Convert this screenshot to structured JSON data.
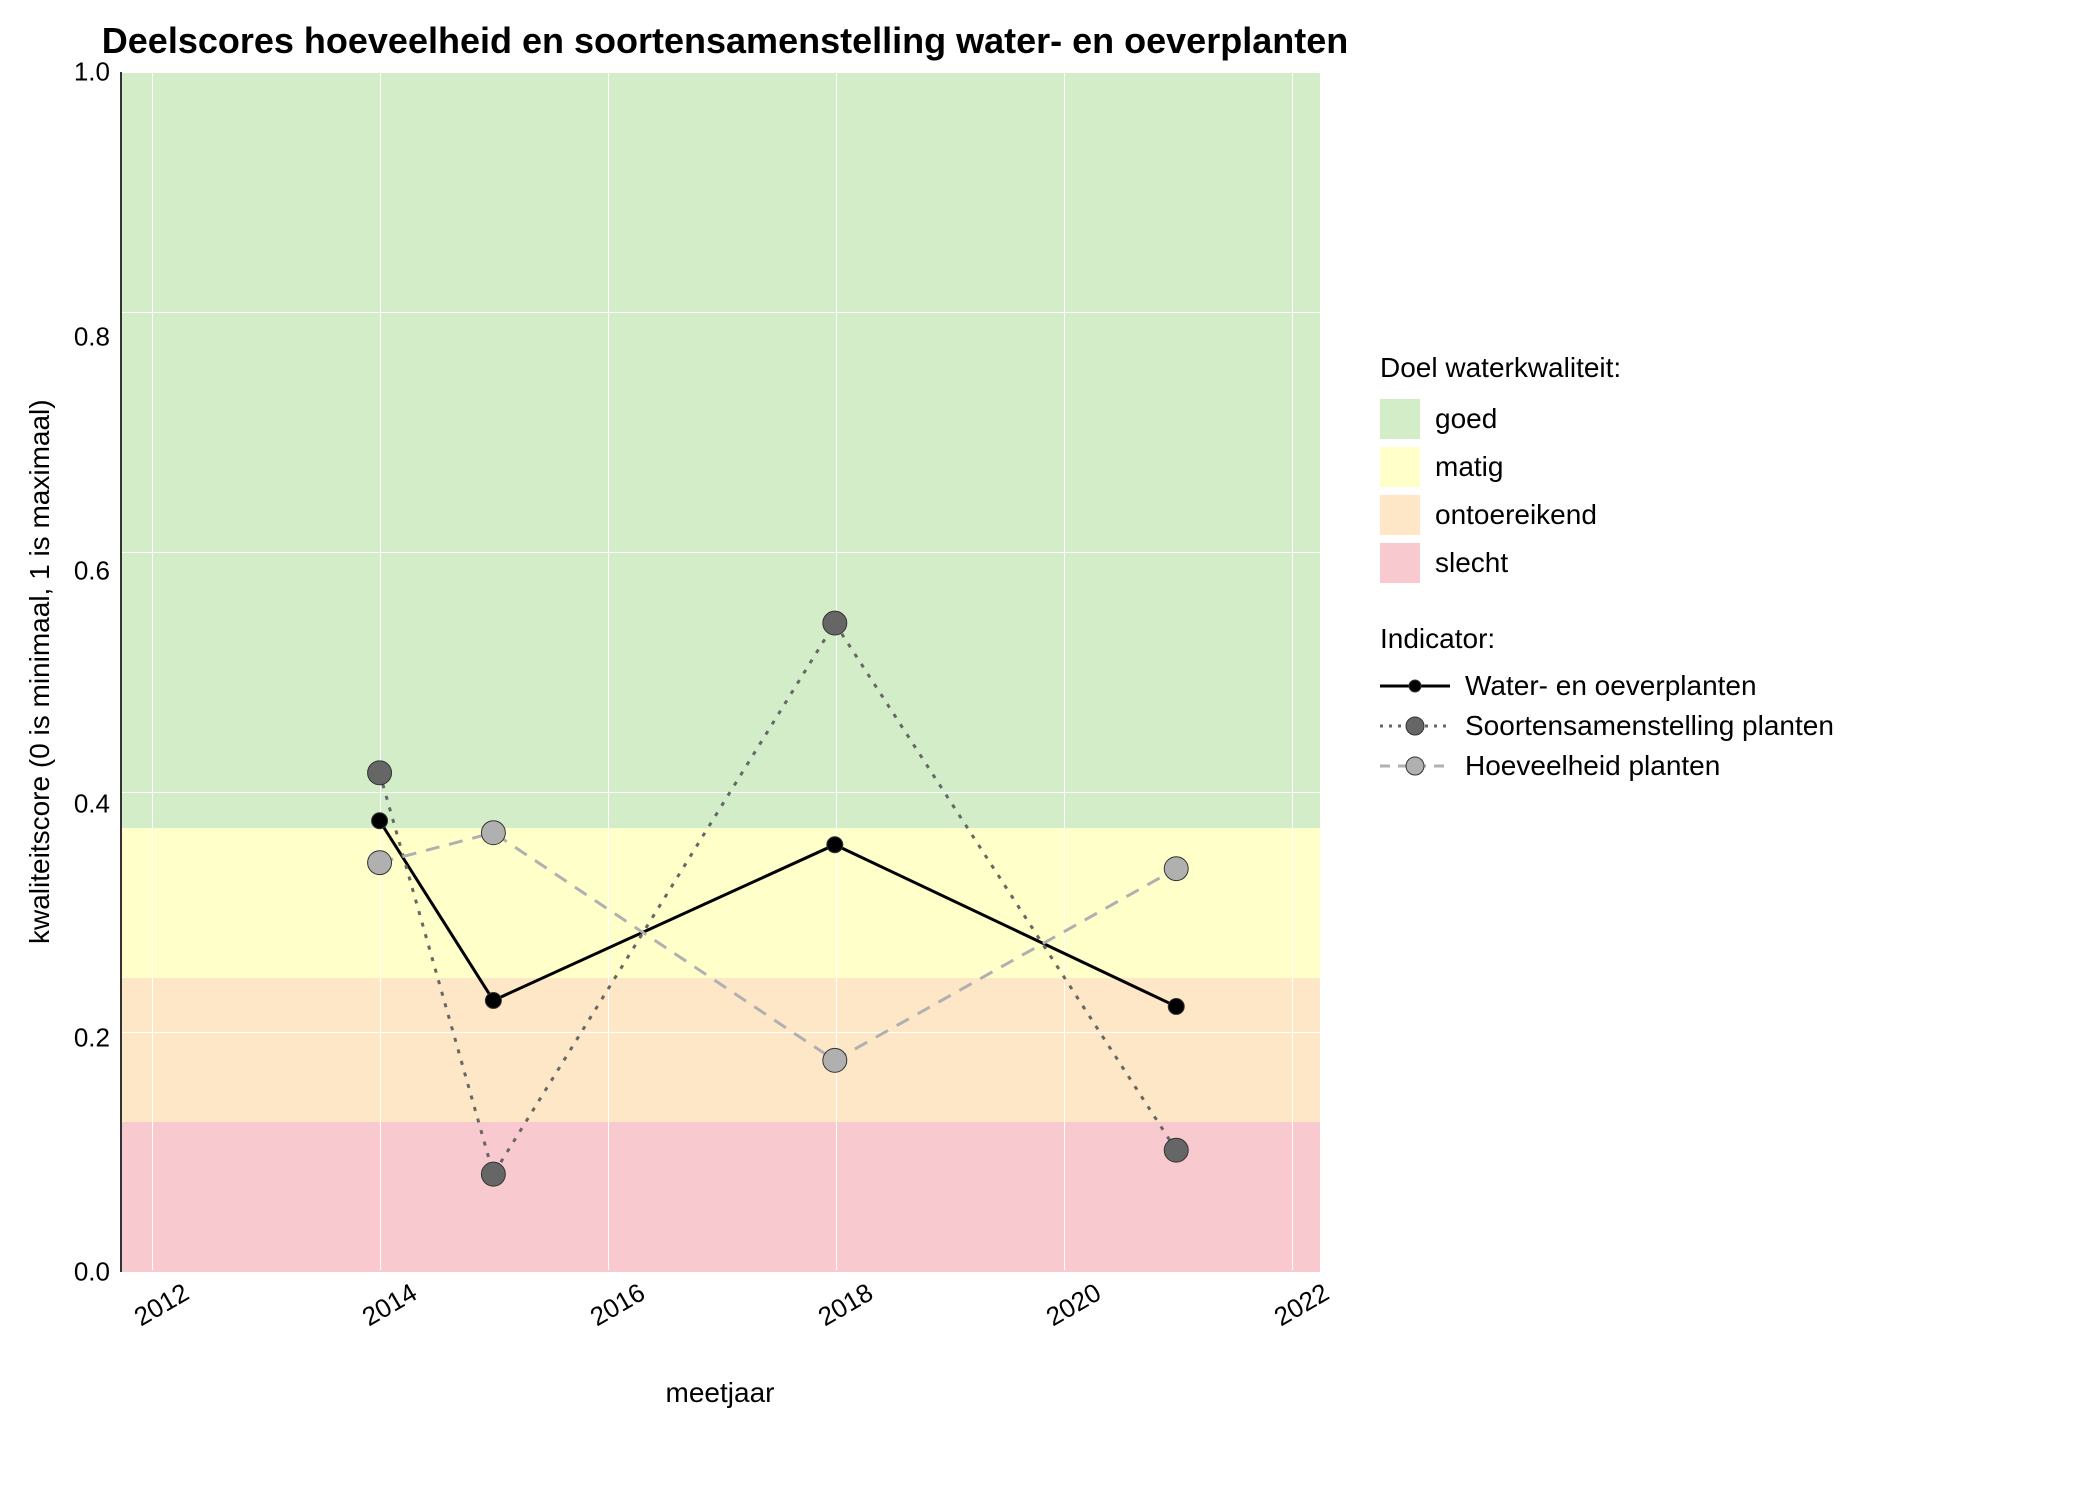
{
  "chart_data": {
    "type": "line",
    "title": "Deelscores hoeveelheid en soortensamenstelling water- en oeverplanten",
    "xlabel": "meetjaar",
    "ylabel": "kwaliteitscore (0 is minimaal, 1 is maximaal)",
    "xlim": [
      2012,
      2022
    ],
    "ylim": [
      0,
      1
    ],
    "x_ticks": [
      2012,
      2014,
      2016,
      2018,
      2020,
      2022
    ],
    "y_ticks": [
      0.0,
      0.2,
      0.4,
      0.6,
      0.8,
      1.0
    ],
    "x": [
      2014,
      2015,
      2018,
      2021
    ],
    "series": [
      {
        "name": "Water- en oeverplanten",
        "values": [
          0.375,
          0.225,
          0.355,
          0.22
        ],
        "color": "#000000",
        "dash": "solid",
        "point_fill": "#000000"
      },
      {
        "name": "Soortensamenstelling planten",
        "values": [
          0.415,
          0.08,
          0.54,
          0.1
        ],
        "color": "#666666",
        "dash": "dotted",
        "point_fill": "#666666"
      },
      {
        "name": "Hoeveelheid planten",
        "values": [
          0.34,
          0.365,
          0.175,
          0.335
        ],
        "color": "#b0b0b0",
        "dash": "dashed",
        "point_fill": "#b0b0b0"
      }
    ],
    "bands": [
      {
        "name": "goed",
        "from": 0.37,
        "to": 1.0,
        "color": "#d4edc9"
      },
      {
        "name": "matig",
        "from": 0.245,
        "to": 0.37,
        "color": "#feffc9"
      },
      {
        "name": "ontoereikend",
        "from": 0.125,
        "to": 0.245,
        "color": "#fee7c6"
      },
      {
        "name": "slecht",
        "from": 0.0,
        "to": 0.125,
        "color": "#f9c9d0"
      }
    ],
    "legend_groups": {
      "bands_title": "Doel waterkwaliteit:",
      "series_title": "Indicator:"
    }
  }
}
